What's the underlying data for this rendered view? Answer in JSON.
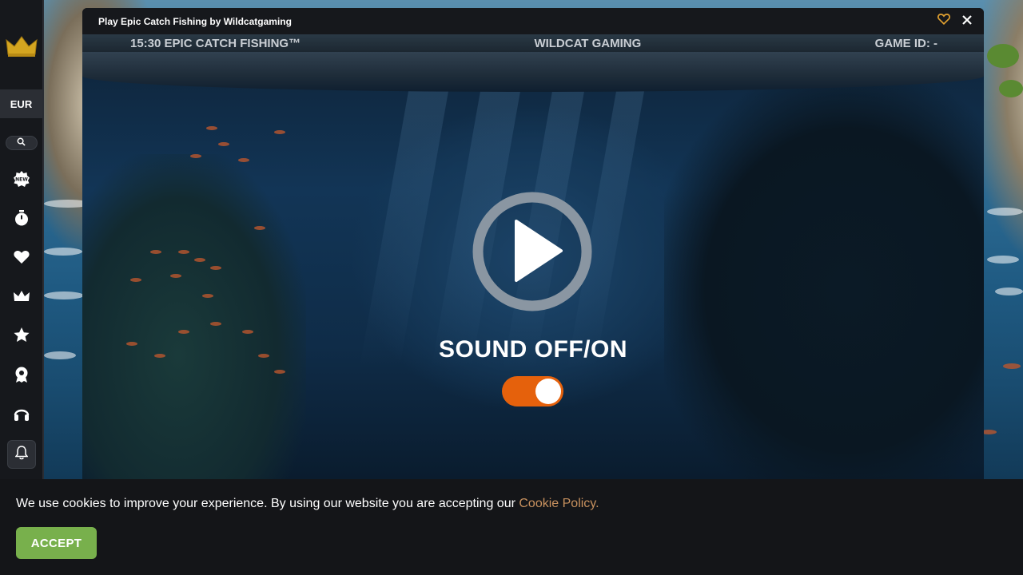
{
  "window": {
    "title": "Play Epic Catch Fishing by Wildcatgaming"
  },
  "sidebar": {
    "currency": "EUR",
    "nav_icons": [
      "new-badge-icon",
      "stopwatch-icon",
      "heart-icon",
      "crown-icon",
      "star-icon",
      "trophy-badge-icon",
      "headset-icon",
      "bell-icon"
    ]
  },
  "game": {
    "clock_title": "15:30 EPIC CATCH FISHING™",
    "provider": "WILDCAT GAMING",
    "game_id": "GAME ID: -",
    "sound_label": "SOUND OFF/ON",
    "sound_on": true
  },
  "cookie": {
    "message": "We use cookies to improve your experience. By using our website you are accepting our",
    "link_text": "Cookie Policy.",
    "accept_label": "ACCEPT"
  },
  "colors": {
    "accent_orange": "#e5610c",
    "accept_green": "#78b04c",
    "link": "#c8915e",
    "logo_gold": "#d4a520"
  }
}
